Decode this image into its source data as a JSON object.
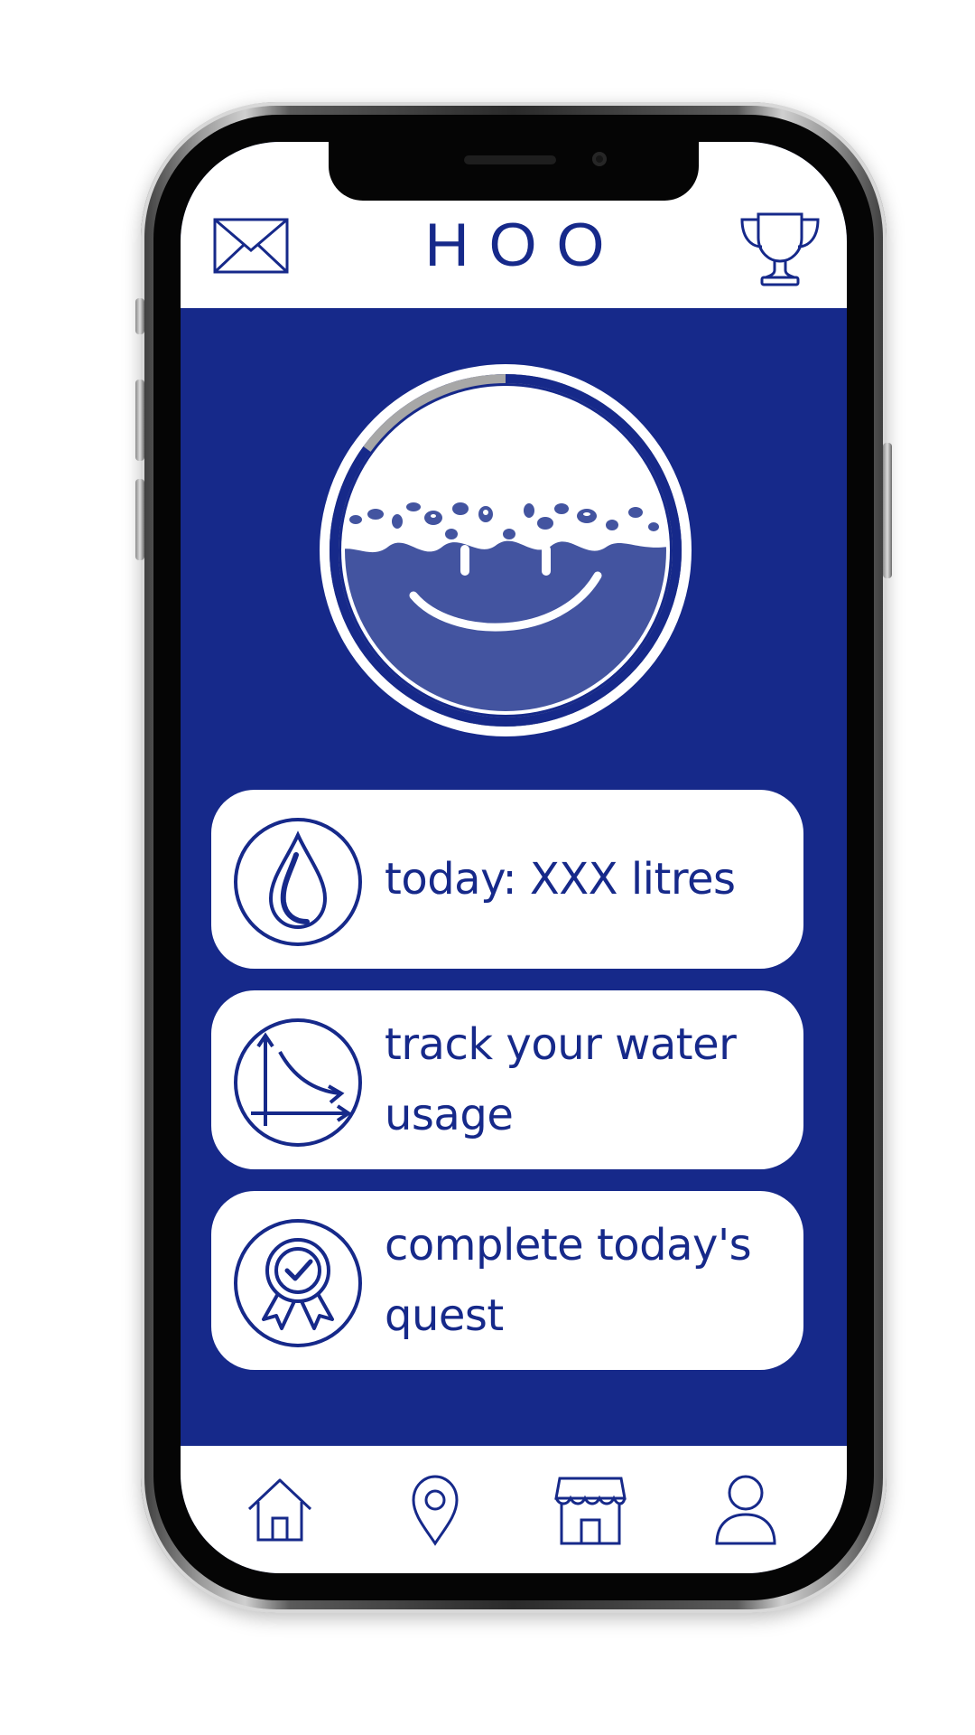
{
  "app": {
    "title": "HOO"
  },
  "header": {
    "left_icon": "mail-icon",
    "right_icon": "trophy-icon"
  },
  "mascot": {
    "icon": "water-smile-icon",
    "daily_progress_fraction": 0.85
  },
  "cards": [
    {
      "icon": "water-drop-icon",
      "label": "today: XXX litres"
    },
    {
      "icon": "usage-graph-icon",
      "label": "track your water usage"
    },
    {
      "icon": "award-badge-icon",
      "label": "complete today's quest"
    }
  ],
  "nav": {
    "items": [
      {
        "icon": "home-icon"
      },
      {
        "icon": "location-pin-icon"
      },
      {
        "icon": "shop-icon"
      },
      {
        "icon": "profile-icon"
      }
    ]
  },
  "colors": {
    "brand_blue": "#16298a",
    "mascot_water": "#4354a0",
    "progress_track": "#a7a7a7",
    "white": "#ffffff"
  }
}
